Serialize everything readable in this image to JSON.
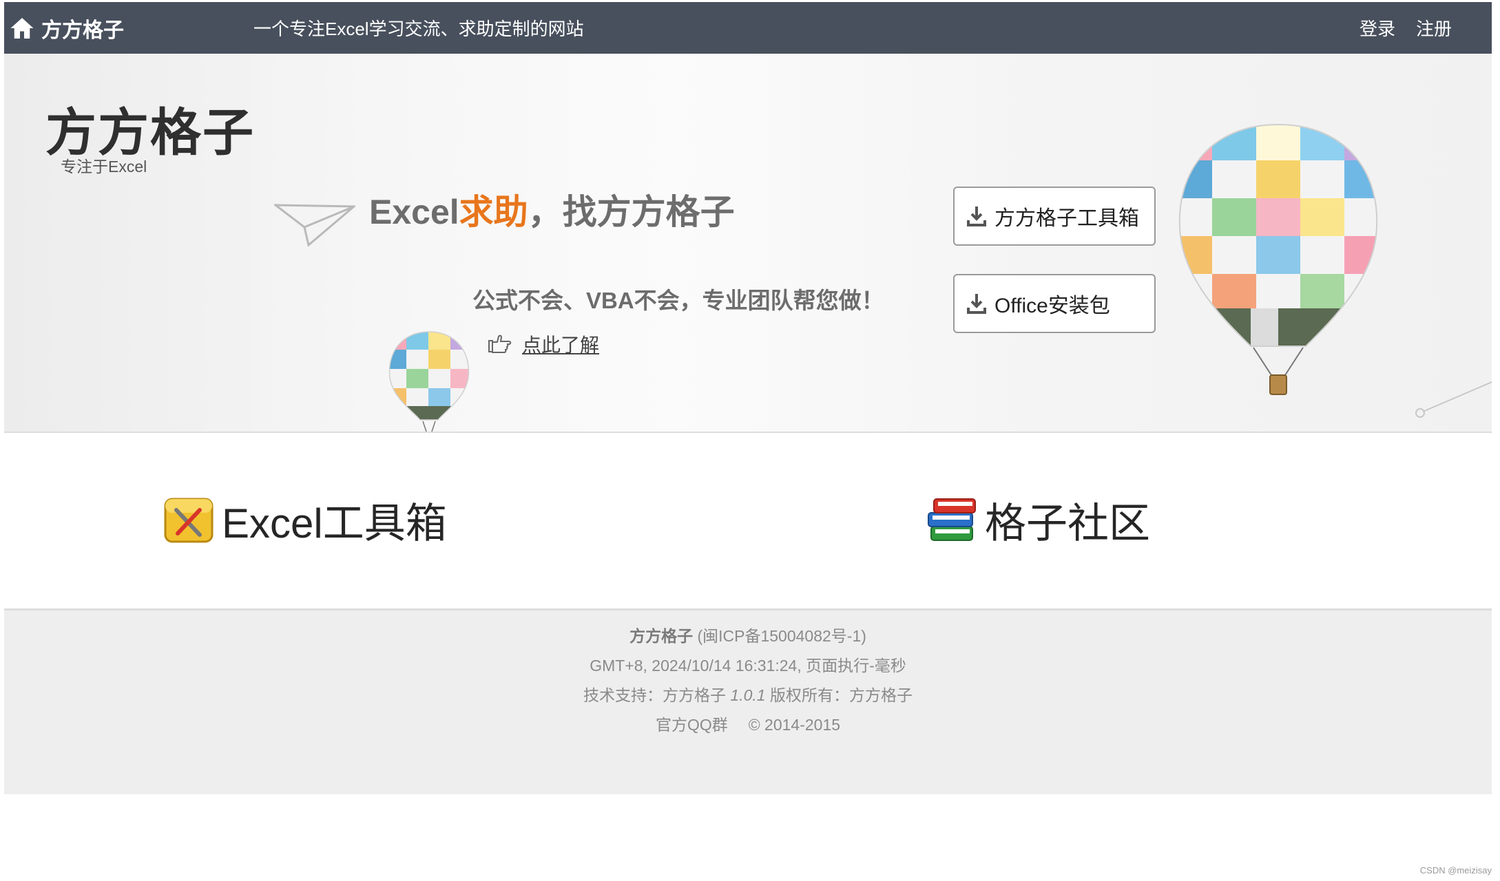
{
  "nav": {
    "brand": "方方格子",
    "tagline": "一个专注Excel学习交流、求助定制的网站",
    "login": "登录",
    "register": "注册"
  },
  "hero": {
    "logo": "方方格子",
    "logo_sub": "专注于Excel",
    "headline_part1": "Excel",
    "headline_accent": "求助",
    "headline_part2": "，找方方格子",
    "subline": "公式不会、VBA不会，专业团队帮您做！",
    "learn_more": "点此了解",
    "download_buttons": [
      {
        "label": "方方格子工具箱"
      },
      {
        "label": "Office安装包"
      }
    ],
    "accent_color": "#e8761c"
  },
  "features": [
    {
      "label": "Excel工具箱",
      "icon": "toolbox-icon"
    },
    {
      "label": "格子社区",
      "icon": "books-icon"
    }
  ],
  "footer": {
    "site_name": "方方格子",
    "icp": "(闽ICP备15004082号-1)",
    "timing": "GMT+8, 2024/10/14 16:31:24, 页面执行-毫秒",
    "support_label": "技术支持：方方格子",
    "version": "1.0.1",
    "copyright_owner": "版权所有：方方格子",
    "qq_group": "官方QQ群",
    "years": "© 2014-2015"
  },
  "watermark": "CSDN @meizisay",
  "colors": {
    "nav_bg": "#48505d",
    "footer_bg": "#eeeeee"
  }
}
